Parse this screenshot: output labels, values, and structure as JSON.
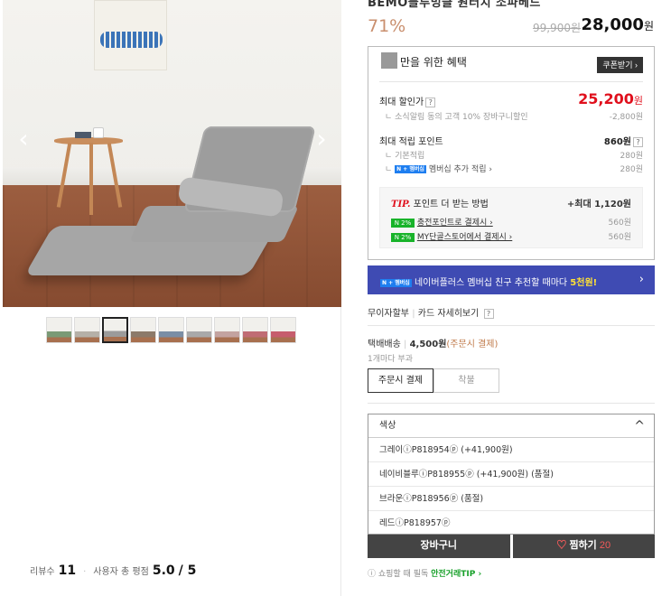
{
  "product": {
    "title_partial": "BEMO블루밍클 원터치 소파베드",
    "discount_rate": "71%",
    "original_price": "99,900원",
    "sale_price": "28,000",
    "sale_unit": "원"
  },
  "benefit": {
    "heading": "만을 위한 혜택",
    "coupon_button": "쿠폰받기 ›",
    "max_discount_label": "최대 할인가",
    "max_discount_value": "25,200",
    "max_discount_unit": "원",
    "discount_sub_label": "소식알림 동의 고객 10% 장바구니할인",
    "discount_sub_value": "-2,800원",
    "points_label": "최대 적립 포인트",
    "points_value": "860원",
    "base_points_label": "기본적립",
    "base_points_value": "280원",
    "membership_badge": "N + 멤버십",
    "membership_label": "멤버십 추가 적립 ›",
    "membership_value": "280원",
    "tip_label": "TIP.",
    "tip_title": "포인트 더 받는 방법",
    "tip_max": "+최대 1,120원",
    "tip_items": [
      {
        "badge": "N 2%",
        "label": "충전포인트로 결제시 ›",
        "value": "560원"
      },
      {
        "badge": "N 2%",
        "label": "MY단골스토어에서 결제시 ›",
        "value": "560원"
      }
    ]
  },
  "banner": {
    "badge": "N + 멤버십",
    "text": "네이버플러스 멤버십 친구 추천할 때마다 ",
    "highlight": "5천원!",
    "arrow": "›"
  },
  "installment": {
    "label": "무이자할부",
    "card_link": "카드 자세히보기"
  },
  "shipping": {
    "label": "택배배송",
    "fee": "4,500원",
    "note": "(주문시 결제)",
    "per_item": "1개마다 부과",
    "tabs": [
      "주문시 결제",
      "착불"
    ]
  },
  "option": {
    "placeholder": "색상",
    "items": [
      "그레이ⓘP818954ⓟ (+41,900원)",
      "네이비블루ⓘP818955ⓟ (+41,900원) (품절)",
      "브라운ⓘP818956ⓟ (품절)",
      "레드ⓘP818957ⓟ"
    ]
  },
  "actions": {
    "cart": "장바구니",
    "wish": "찜하기",
    "wish_count": "20"
  },
  "safe_notice": {
    "text": "ⓘ 쇼핑할 때 필독 ",
    "link": "안전거래TIP ›"
  },
  "reviews": {
    "count_label": "리뷰수",
    "count": "11",
    "rating_label": "사용자 총 평점",
    "rating": "5.0",
    "rating_max": "/ 5"
  },
  "gallery": {
    "prev": "‹",
    "next": "›",
    "thumb_colors": [
      "#7a9a76",
      "#b5b0a8",
      "#9b9b9b",
      "#8c7a6a",
      "#7a8ea5",
      "#a9a9a9",
      "#c3a3a0",
      "#c06c74",
      "#c65d6d"
    ]
  }
}
